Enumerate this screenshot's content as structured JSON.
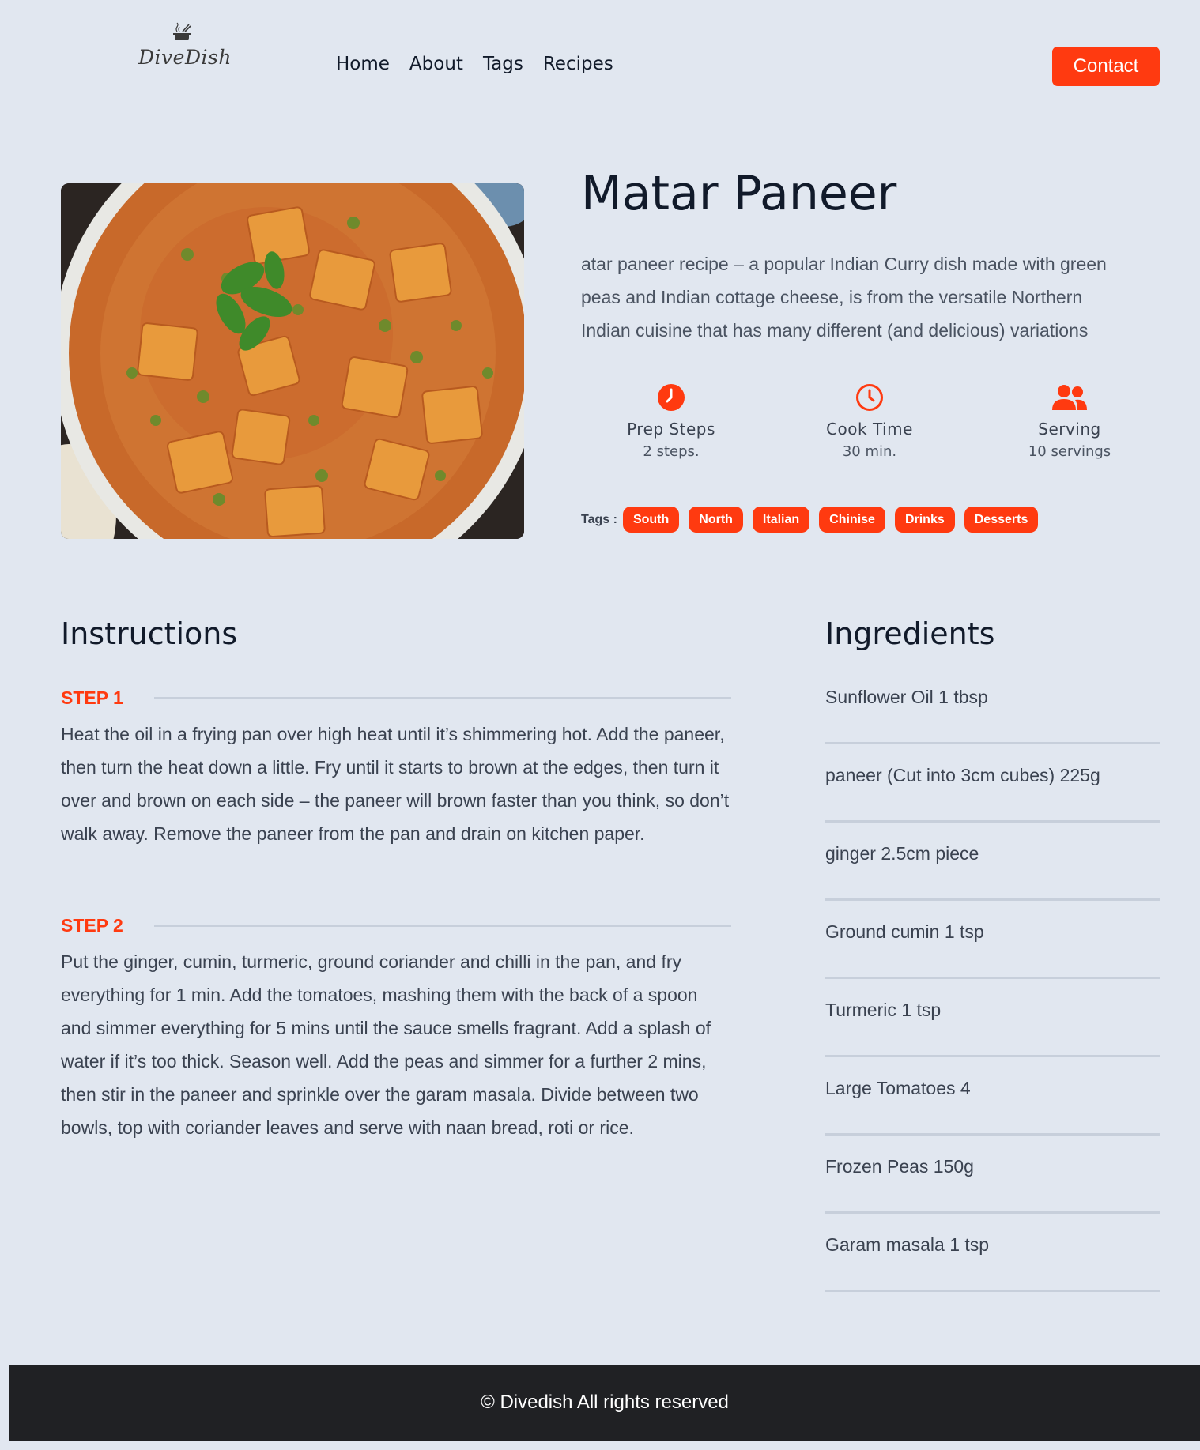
{
  "brand": {
    "name": "DiveDish"
  },
  "nav": {
    "items": [
      "Home",
      "About",
      "Tags",
      "Recipes"
    ],
    "contact_label": "Contact"
  },
  "recipe": {
    "title": "Matar Paneer",
    "description": "atar paneer recipe – a popular Indian Curry dish made with green peas and Indian cottage cheese, is from the versatile Northern Indian cuisine that has many different (and delicious) variations",
    "stats": [
      {
        "icon": "clock-filled-icon",
        "label": "Prep Steps",
        "value": "2 steps."
      },
      {
        "icon": "clock-outline-icon",
        "label": "Cook Time",
        "value": "30 min."
      },
      {
        "icon": "users-icon",
        "label": "Serving",
        "value": "10 servings"
      }
    ],
    "tags_label": "Tags :",
    "tags": [
      "South",
      "North",
      "Italian",
      "Chinise",
      "Drinks",
      "Desserts"
    ]
  },
  "instructions": {
    "heading": "Instructions",
    "steps": [
      {
        "label": "STEP 1",
        "text": "Heat the oil in a frying pan over high heat until it’s shimmering hot. Add the paneer, then turn the heat down a little. Fry until it starts to brown at the edges, then turn it over and brown on each side – the paneer will brown faster than you think, so don’t walk away. Remove the paneer from the pan and drain on kitchen paper."
      },
      {
        "label": "STEP 2",
        "text": "Put the ginger, cumin, turmeric, ground coriander and chilli in the pan, and fry everything for 1 min. Add the tomatoes, mashing them with the back of a spoon and simmer everything for 5 mins until the sauce smells fragrant. Add a splash of water if it’s too thick. Season well. Add the peas and simmer for a further 2 mins, then stir in the paneer and sprinkle over the garam masala. Divide between two bowls, top with coriander leaves and serve with naan bread, roti or rice."
      }
    ]
  },
  "ingredients": {
    "heading": "Ingredients",
    "items": [
      "Sunflower Oil 1 tbsp",
      "paneer (Cut into 3cm cubes) 225g",
      "ginger 2.5cm piece",
      "Ground cumin 1 tsp",
      "Turmeric 1 tsp",
      "Large Tomatoes 4",
      "Frozen Peas 150g",
      "Garam masala 1 tsp"
    ]
  },
  "footer": {
    "text": "© Divedish All rights reserved"
  },
  "colors": {
    "accent": "#ff3a10",
    "background": "#e1e7f0",
    "footer": "#202124"
  }
}
